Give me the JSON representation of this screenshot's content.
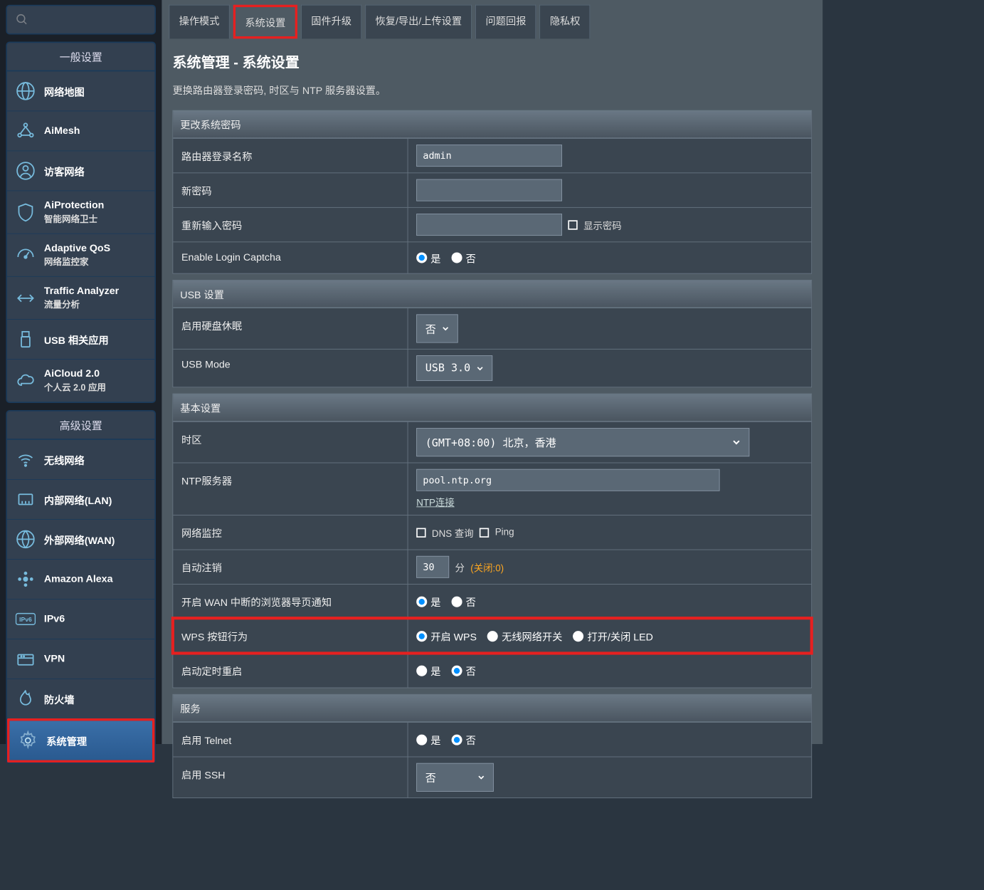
{
  "sidebar": {
    "general": {
      "header": "一般设置",
      "items": [
        {
          "label": "网络地图",
          "sub": null,
          "icon": "globe"
        },
        {
          "label": "AiMesh",
          "sub": null,
          "icon": "mesh"
        },
        {
          "label": "访客网络",
          "sub": null,
          "icon": "guest"
        },
        {
          "label": "AiProtection",
          "sub": "智能网络卫士",
          "icon": "shield"
        },
        {
          "label": "Adaptive QoS",
          "sub": "网络监控家",
          "icon": "gauge"
        },
        {
          "label": "Traffic Analyzer",
          "sub": "流量分析",
          "icon": "traffic"
        },
        {
          "label": "USB 相关应用",
          "sub": null,
          "icon": "usb"
        },
        {
          "label": "AiCloud 2.0",
          "sub": "个人云 2.0 应用",
          "icon": "cloud"
        }
      ]
    },
    "advanced": {
      "header": "高级设置",
      "items": [
        {
          "label": "无线网络",
          "icon": "wifi"
        },
        {
          "label": "内部网络(LAN)",
          "icon": "lan"
        },
        {
          "label": "外部网络(WAN)",
          "icon": "wan"
        },
        {
          "label": "Amazon Alexa",
          "icon": "alexa"
        },
        {
          "label": "IPv6",
          "icon": "ipv6"
        },
        {
          "label": "VPN",
          "icon": "vpn"
        },
        {
          "label": "防火墙",
          "icon": "fire"
        },
        {
          "label": "系统管理",
          "icon": "gear",
          "active": true
        }
      ]
    }
  },
  "tabs": [
    "操作模式",
    "系统设置",
    "固件升级",
    "恢复/导出/上传设置",
    "问题回报",
    "隐私权"
  ],
  "page": {
    "title": "系统管理 - 系统设置",
    "subtitle": "更换路由器登录密码, 时区与 NTP 服务器设置。"
  },
  "sections": {
    "password": {
      "header": "更改系统密码",
      "loginNameLabel": "路由器登录名称",
      "loginNameValue": "admin",
      "newPassLabel": "新密码",
      "retypeLabel": "重新输入密码",
      "showPassLabel": "显示密码",
      "captchaLabel": "Enable Login Captcha",
      "yes": "是",
      "no": "否"
    },
    "usb": {
      "header": "USB 设置",
      "hddSleepLabel": "启用硬盘休眠",
      "hddSleepValue": "否",
      "usbModeLabel": "USB Mode",
      "usbModeValue": "USB 3.0"
    },
    "basic": {
      "header": "基本设置",
      "tzLabel": "时区",
      "tzValue": "(GMT+08:00) 北京，香港",
      "ntpLabel": "NTP服务器",
      "ntpValue": "pool.ntp.org",
      "ntpLink": "NTP连接",
      "monitorLabel": "网络监控",
      "dnsQuery": "DNS 查询",
      "ping": "Ping",
      "autoLogoutLabel": "自动注销",
      "autoLogoutValue": "30",
      "autoLogoutUnit": "分",
      "autoLogoutHint": "(关闭:0)",
      "wanNotifyLabel": "开启 WAN 中断的浏览器导页通知",
      "wpsLabel": "WPS 按钮行为",
      "wpsOpt1": "开启 WPS",
      "wpsOpt2": "无线网络开关",
      "wpsOpt3": "打开/关闭 LED",
      "rebootLabel": "启动定时重启",
      "yes": "是",
      "no": "否"
    },
    "service": {
      "header": "服务",
      "telnetLabel": "启用 Telnet",
      "sshLabel": "启用 SSH",
      "sshValue": "否",
      "yes": "是",
      "no": "否"
    }
  }
}
